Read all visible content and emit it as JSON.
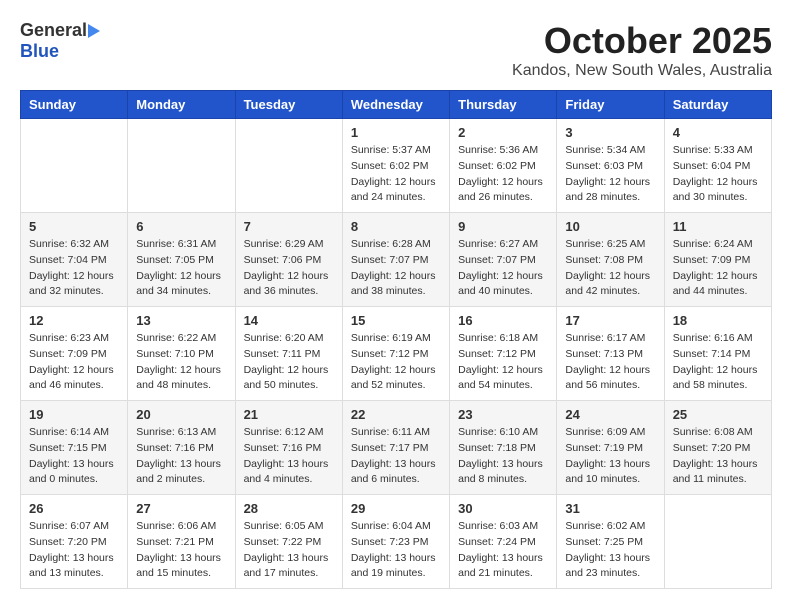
{
  "header": {
    "logo_general": "General",
    "logo_blue": "Blue",
    "month_title": "October 2025",
    "location": "Kandos, New South Wales, Australia"
  },
  "weekdays": [
    "Sunday",
    "Monday",
    "Tuesday",
    "Wednesday",
    "Thursday",
    "Friday",
    "Saturday"
  ],
  "weeks": [
    [
      {
        "day": "",
        "sunrise": "",
        "sunset": "",
        "daylight": ""
      },
      {
        "day": "",
        "sunrise": "",
        "sunset": "",
        "daylight": ""
      },
      {
        "day": "",
        "sunrise": "",
        "sunset": "",
        "daylight": ""
      },
      {
        "day": "1",
        "sunrise": "Sunrise: 5:37 AM",
        "sunset": "Sunset: 6:02 PM",
        "daylight": "Daylight: 12 hours and 24 minutes."
      },
      {
        "day": "2",
        "sunrise": "Sunrise: 5:36 AM",
        "sunset": "Sunset: 6:02 PM",
        "daylight": "Daylight: 12 hours and 26 minutes."
      },
      {
        "day": "3",
        "sunrise": "Sunrise: 5:34 AM",
        "sunset": "Sunset: 6:03 PM",
        "daylight": "Daylight: 12 hours and 28 minutes."
      },
      {
        "day": "4",
        "sunrise": "Sunrise: 5:33 AM",
        "sunset": "Sunset: 6:04 PM",
        "daylight": "Daylight: 12 hours and 30 minutes."
      }
    ],
    [
      {
        "day": "5",
        "sunrise": "Sunrise: 6:32 AM",
        "sunset": "Sunset: 7:04 PM",
        "daylight": "Daylight: 12 hours and 32 minutes."
      },
      {
        "day": "6",
        "sunrise": "Sunrise: 6:31 AM",
        "sunset": "Sunset: 7:05 PM",
        "daylight": "Daylight: 12 hours and 34 minutes."
      },
      {
        "day": "7",
        "sunrise": "Sunrise: 6:29 AM",
        "sunset": "Sunset: 7:06 PM",
        "daylight": "Daylight: 12 hours and 36 minutes."
      },
      {
        "day": "8",
        "sunrise": "Sunrise: 6:28 AM",
        "sunset": "Sunset: 7:07 PM",
        "daylight": "Daylight: 12 hours and 38 minutes."
      },
      {
        "day": "9",
        "sunrise": "Sunrise: 6:27 AM",
        "sunset": "Sunset: 7:07 PM",
        "daylight": "Daylight: 12 hours and 40 minutes."
      },
      {
        "day": "10",
        "sunrise": "Sunrise: 6:25 AM",
        "sunset": "Sunset: 7:08 PM",
        "daylight": "Daylight: 12 hours and 42 minutes."
      },
      {
        "day": "11",
        "sunrise": "Sunrise: 6:24 AM",
        "sunset": "Sunset: 7:09 PM",
        "daylight": "Daylight: 12 hours and 44 minutes."
      }
    ],
    [
      {
        "day": "12",
        "sunrise": "Sunrise: 6:23 AM",
        "sunset": "Sunset: 7:09 PM",
        "daylight": "Daylight: 12 hours and 46 minutes."
      },
      {
        "day": "13",
        "sunrise": "Sunrise: 6:22 AM",
        "sunset": "Sunset: 7:10 PM",
        "daylight": "Daylight: 12 hours and 48 minutes."
      },
      {
        "day": "14",
        "sunrise": "Sunrise: 6:20 AM",
        "sunset": "Sunset: 7:11 PM",
        "daylight": "Daylight: 12 hours and 50 minutes."
      },
      {
        "day": "15",
        "sunrise": "Sunrise: 6:19 AM",
        "sunset": "Sunset: 7:12 PM",
        "daylight": "Daylight: 12 hours and 52 minutes."
      },
      {
        "day": "16",
        "sunrise": "Sunrise: 6:18 AM",
        "sunset": "Sunset: 7:12 PM",
        "daylight": "Daylight: 12 hours and 54 minutes."
      },
      {
        "day": "17",
        "sunrise": "Sunrise: 6:17 AM",
        "sunset": "Sunset: 7:13 PM",
        "daylight": "Daylight: 12 hours and 56 minutes."
      },
      {
        "day": "18",
        "sunrise": "Sunrise: 6:16 AM",
        "sunset": "Sunset: 7:14 PM",
        "daylight": "Daylight: 12 hours and 58 minutes."
      }
    ],
    [
      {
        "day": "19",
        "sunrise": "Sunrise: 6:14 AM",
        "sunset": "Sunset: 7:15 PM",
        "daylight": "Daylight: 13 hours and 0 minutes."
      },
      {
        "day": "20",
        "sunrise": "Sunrise: 6:13 AM",
        "sunset": "Sunset: 7:16 PM",
        "daylight": "Daylight: 13 hours and 2 minutes."
      },
      {
        "day": "21",
        "sunrise": "Sunrise: 6:12 AM",
        "sunset": "Sunset: 7:16 PM",
        "daylight": "Daylight: 13 hours and 4 minutes."
      },
      {
        "day": "22",
        "sunrise": "Sunrise: 6:11 AM",
        "sunset": "Sunset: 7:17 PM",
        "daylight": "Daylight: 13 hours and 6 minutes."
      },
      {
        "day": "23",
        "sunrise": "Sunrise: 6:10 AM",
        "sunset": "Sunset: 7:18 PM",
        "daylight": "Daylight: 13 hours and 8 minutes."
      },
      {
        "day": "24",
        "sunrise": "Sunrise: 6:09 AM",
        "sunset": "Sunset: 7:19 PM",
        "daylight": "Daylight: 13 hours and 10 minutes."
      },
      {
        "day": "25",
        "sunrise": "Sunrise: 6:08 AM",
        "sunset": "Sunset: 7:20 PM",
        "daylight": "Daylight: 13 hours and 11 minutes."
      }
    ],
    [
      {
        "day": "26",
        "sunrise": "Sunrise: 6:07 AM",
        "sunset": "Sunset: 7:20 PM",
        "daylight": "Daylight: 13 hours and 13 minutes."
      },
      {
        "day": "27",
        "sunrise": "Sunrise: 6:06 AM",
        "sunset": "Sunset: 7:21 PM",
        "daylight": "Daylight: 13 hours and 15 minutes."
      },
      {
        "day": "28",
        "sunrise": "Sunrise: 6:05 AM",
        "sunset": "Sunset: 7:22 PM",
        "daylight": "Daylight: 13 hours and 17 minutes."
      },
      {
        "day": "29",
        "sunrise": "Sunrise: 6:04 AM",
        "sunset": "Sunset: 7:23 PM",
        "daylight": "Daylight: 13 hours and 19 minutes."
      },
      {
        "day": "30",
        "sunrise": "Sunrise: 6:03 AM",
        "sunset": "Sunset: 7:24 PM",
        "daylight": "Daylight: 13 hours and 21 minutes."
      },
      {
        "day": "31",
        "sunrise": "Sunrise: 6:02 AM",
        "sunset": "Sunset: 7:25 PM",
        "daylight": "Daylight: 13 hours and 23 minutes."
      },
      {
        "day": "",
        "sunrise": "",
        "sunset": "",
        "daylight": ""
      }
    ]
  ]
}
